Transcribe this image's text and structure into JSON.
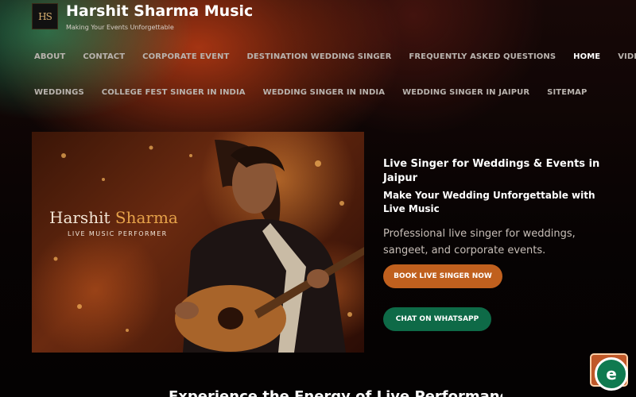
{
  "header": {
    "logo_text": "HS",
    "site_title": "Harshit Sharma Music",
    "tagline": "Making Your Events Unforgettable"
  },
  "nav": {
    "row1": [
      "ABOUT",
      "CONTACT",
      "CORPORATE EVENT",
      "DESTINATION WEDDING SINGER",
      "FREQUENTLY ASKED QUESTIONS",
      "HOME",
      "VIDEOS"
    ],
    "row2": [
      "WEDDINGS",
      "COLLEGE FEST SINGER IN INDIA",
      "WEDDING SINGER IN INDIA",
      "WEDDING SINGER IN JAIPUR",
      "SITEMAP"
    ],
    "active": "HOME"
  },
  "hero": {
    "image_name_first": "Harshit",
    "image_name_last": "Sharma",
    "image_subtitle": "LIVE MUSIC PERFORMER",
    "heading1": "Live Singer for Weddings & Events in Jaipur",
    "heading2": "Make Your Wedding Unforgettable with Live Music",
    "description": "Professional live singer for weddings, sangeet, and corporate events.",
    "book_button": "BOOK LIVE SINGER NOW",
    "chat_button": "CHAT ON WHATSAPP"
  },
  "section": {
    "heading": "Experience the Energy of Live Performance"
  },
  "colors": {
    "accent_orange": "#c0601e",
    "accent_green": "#0e6a47",
    "background": "#070303"
  },
  "widget": {
    "icon": "chat-widget-icon",
    "glyph": "e"
  }
}
